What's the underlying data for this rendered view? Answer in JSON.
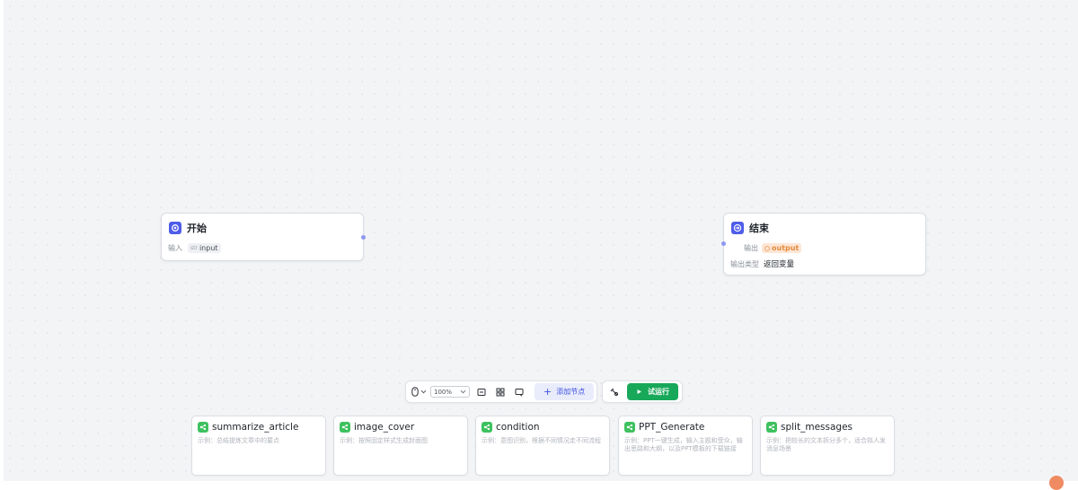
{
  "colors": {
    "accent": "#4f5de8",
    "run_green": "#18a85a",
    "card_icon_green": "#3ec15f",
    "output_tag": "#fde6d6"
  },
  "start_node": {
    "title": "开始",
    "icon": "start-icon",
    "input_label": "输入",
    "var_type": "str",
    "var_name": "input"
  },
  "end_node": {
    "title": "结束",
    "icon": "end-icon",
    "output_label": "输出",
    "output_var": "output",
    "output_type_label": "输出类型",
    "output_type_value": "返回变量"
  },
  "toolbar": {
    "zoom": "100%",
    "add_node_label": "添加节点",
    "run_label": "试运行",
    "icons": [
      "mouse-icon",
      "fit-view-icon",
      "minimap-icon",
      "comment-icon",
      "tool-icon",
      "play-icon"
    ]
  },
  "templates": [
    {
      "title": "summarize_article",
      "desc": "示例：总结提炼文章中的要点"
    },
    {
      "title": "image_cover",
      "desc": "示例：按照固定样式生成封面图"
    },
    {
      "title": "condition",
      "desc": "示例：意图识别，根据不同情况走不同流程"
    },
    {
      "title": "PPT_Generate",
      "desc": "示例：PPT一键生成，输入主题和受众，输出思路和大纲，以及PPT模板的下载链接"
    },
    {
      "title": "split_messages",
      "desc": "示例：把较长的文本拆分多个，适合拟人发消息场景"
    }
  ]
}
